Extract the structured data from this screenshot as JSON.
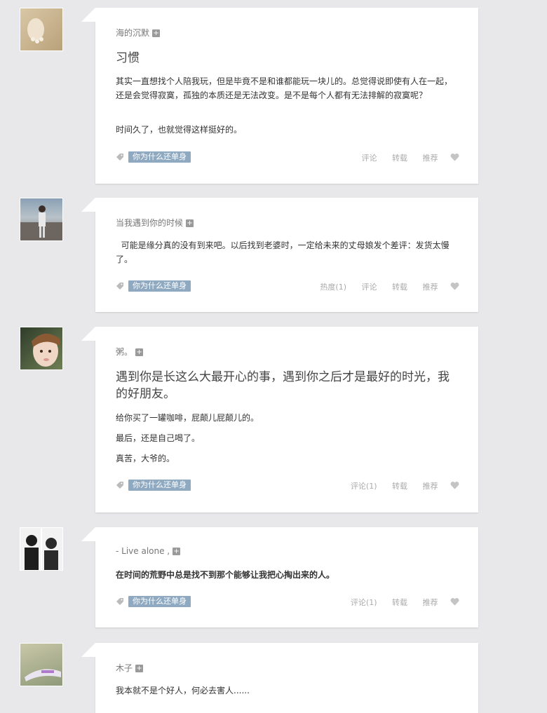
{
  "posts": [
    {
      "author": "海的沉默",
      "title": "习惯",
      "paragraphs": [
        "其实一直想找个人陪我玩，但是毕竟不是和谁都能玩一块儿的。总觉得说即使有人在一起，还是会觉得寂寞，孤独的本质还是无法改变。是不是每个人都有无法排解的寂寞呢？",
        "时间久了，也就觉得这样挺好的。"
      ],
      "tag": "你为什么还单身",
      "actions": [
        "评论",
        "转载",
        "推荐"
      ]
    },
    {
      "author": "当我遇到你的时候",
      "title": "",
      "paragraphs": [
        "  可能是缘分真的没有到来吧。以后找到老婆时，一定给未来的丈母娘发个差评：发货太慢了。"
      ],
      "tag": "你为什么还单身",
      "actions": [
        "热度(1)",
        "评论",
        "转载",
        "推荐"
      ]
    },
    {
      "author": "粥。",
      "title": "遇到你是长这么大最开心的事，遇到你之后才是最好的时光，我的好朋友。",
      "paragraphs": [
        "给你买了一罐咖啡，屁颠儿屁颠儿的。",
        "最后，还是自己喝了。",
        "真苦，大爷的。"
      ],
      "tag": "你为什么还单身",
      "actions": [
        "评论(1)",
        "转载",
        "推荐"
      ]
    },
    {
      "author": "- Live alone ,",
      "title": "",
      "paragraphs": [
        "在时间的荒野中总是找不到那个能够让我把心掏出来的人。"
      ],
      "tag": "你为什么还单身",
      "actions": [
        "评论(1)",
        "转载",
        "推荐"
      ]
    },
    {
      "author": "木子",
      "title": "",
      "paragraphs": [
        "我本就不是个好人，何必去害人......"
      ],
      "tag": "",
      "actions": []
    }
  ]
}
